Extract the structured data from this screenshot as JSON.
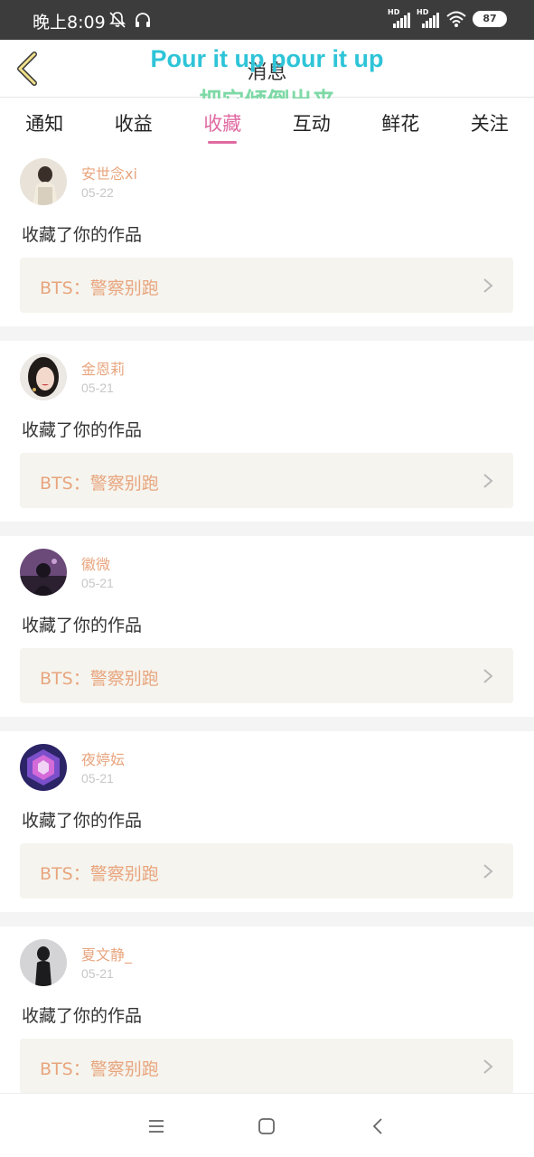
{
  "status_bar": {
    "time": "晚上8:09",
    "icons": [
      "mute-icon",
      "headset-icon",
      "hd-signal-icon",
      "hd-signal-icon",
      "wifi-icon"
    ],
    "battery": "87"
  },
  "header": {
    "title": "消息",
    "overlay_line1": "Pour it up pour it up",
    "overlay_line2": "把它倾倒出来",
    "accent_color": "#e06aa2"
  },
  "tabs": [
    {
      "label": "通知"
    },
    {
      "label": "收益"
    },
    {
      "label": "收藏",
      "active": true
    },
    {
      "label": "互动"
    },
    {
      "label": "鲜花"
    },
    {
      "label": "关注"
    }
  ],
  "feed": {
    "items": [
      {
        "username": "安世念xi",
        "date": "05-22",
        "action": "收藏了你的作品",
        "work": "BTS：警察别跑"
      },
      {
        "username": "金恩莉",
        "date": "05-21",
        "action": "收藏了你的作品",
        "work": "BTS：警察别跑"
      },
      {
        "username": "徽微",
        "date": "05-21",
        "action": "收藏了你的作品",
        "work": "BTS：警察别跑"
      },
      {
        "username": "夜婷妘",
        "date": "05-21",
        "action": "收藏了你的作品",
        "work": "BTS：警察别跑"
      },
      {
        "username": "夏文静_",
        "date": "05-21",
        "action": "收藏了你的作品",
        "work": "BTS：警察别跑"
      }
    ]
  },
  "nav_bar": {
    "icons": [
      "menu-icon",
      "home-icon",
      "back-icon"
    ]
  }
}
